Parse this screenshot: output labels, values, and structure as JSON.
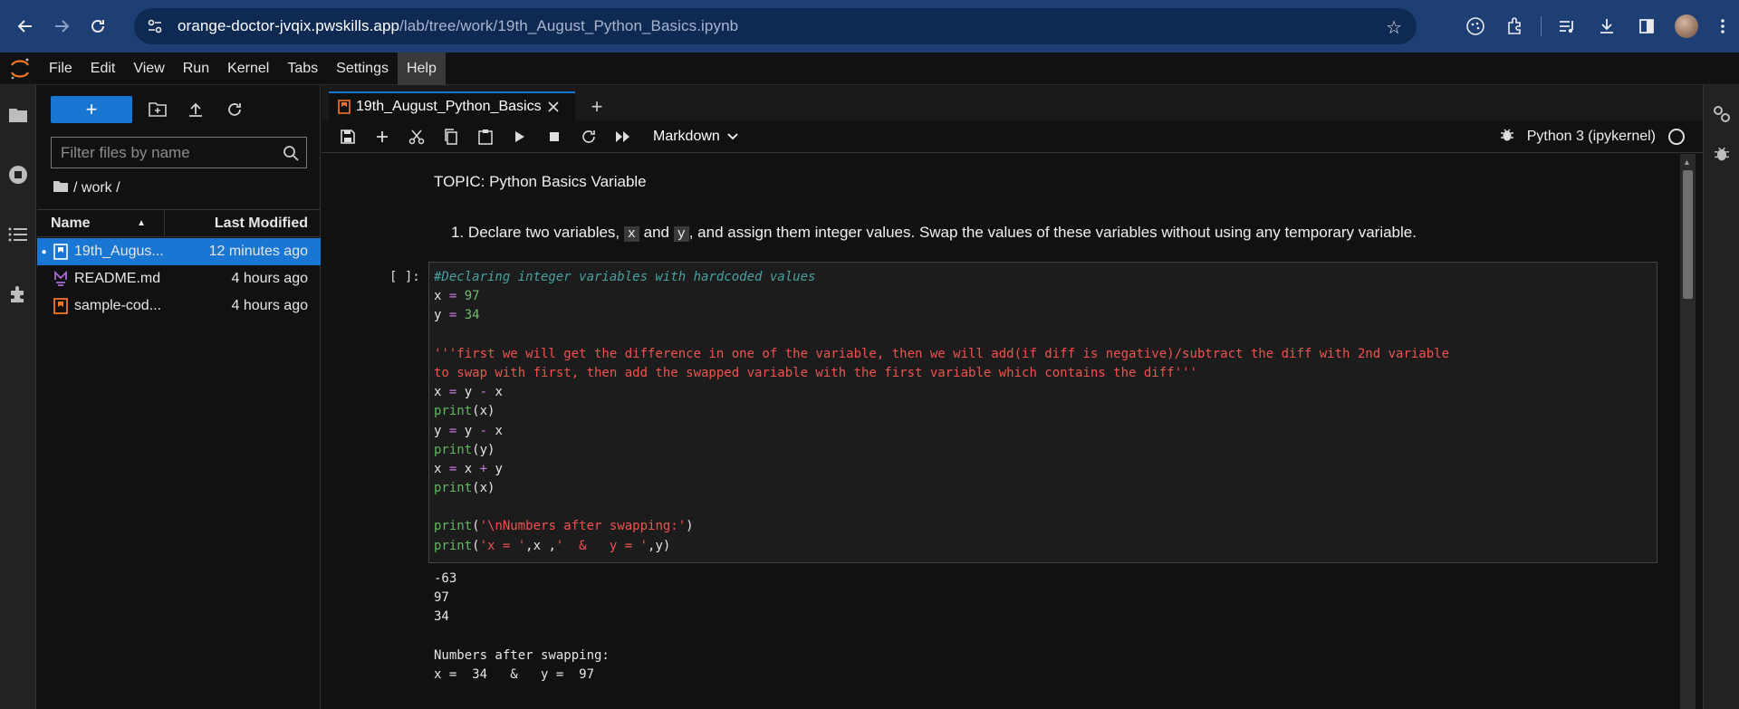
{
  "browser": {
    "url_host": "orange-doctor-jvqix.pwskills.app",
    "url_path": "/lab/tree/work/19th_August_Python_Basics.ipynb"
  },
  "menu": [
    "File",
    "Edit",
    "View",
    "Run",
    "Kernel",
    "Tabs",
    "Settings",
    "Help"
  ],
  "file_browser": {
    "filter_placeholder": "Filter files by name",
    "breadcrumb": "/ work /",
    "col_name": "Name",
    "col_modified": "Last Modified",
    "files": [
      {
        "name": "19th_Augus...",
        "modified": "12 minutes ago",
        "selected": true,
        "icon": "notebook-icon"
      },
      {
        "name": "README.md",
        "modified": "4 hours ago",
        "selected": false,
        "icon": "markdown-icon"
      },
      {
        "name": "sample-cod...",
        "modified": "4 hours ago",
        "selected": false,
        "icon": "notebook-icon"
      }
    ]
  },
  "tab": {
    "label": "19th_August_Python_Basics.i"
  },
  "toolbar": {
    "cell_type": "Markdown",
    "kernel": "Python 3 (ipykernel)"
  },
  "notebook": {
    "topic": "TOPIC: Python Basics Variable",
    "question_num": "1.",
    "question_a": "Declare two variables, ",
    "question_x": "x",
    "question_and": " and ",
    "question_y": "y",
    "question_b": ", and assign them integer values. Swap the values of these variables without using any temporary variable.",
    "prompt": "[ ]:",
    "code": [
      "#Declaring integer variables with hardcoded values",
      "x = 97",
      "y = 34",
      "",
      "'''first we will get the difference in one of the variable, then we will add(if diff is negative)/subtract the diff with 2nd variable",
      "to swap with first, then add the swapped variable with the first variable which contains the diff'''",
      "x = y - x",
      "print(x)",
      "y = y - x",
      "print(y)",
      "x = x + y",
      "print(x)",
      "",
      "print('\\nNumbers after swapping:')",
      "print('x = ',x ,'  &   y = ',y)"
    ],
    "output": [
      "-63",
      "97",
      "34",
      "",
      "Numbers after swapping:",
      "x =  34   &   y =  97"
    ]
  }
}
